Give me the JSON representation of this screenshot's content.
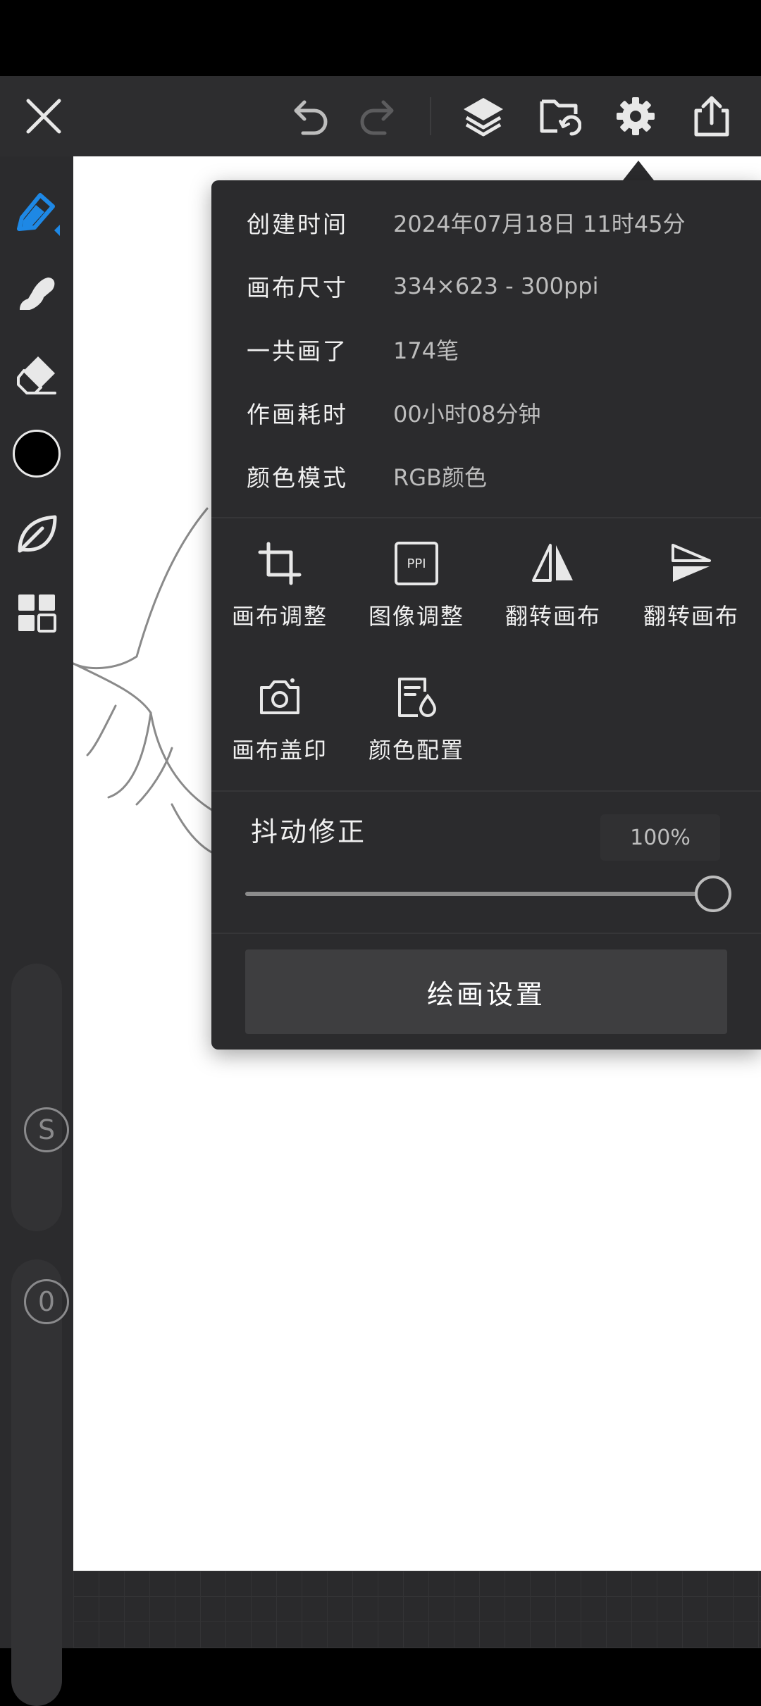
{
  "toolbar": {
    "close": "close-icon",
    "undo": "undo-icon",
    "redo": "redo-icon",
    "layers": "layers-icon",
    "save": "save-folder-icon",
    "settings": "gear-icon",
    "share": "share-icon"
  },
  "left_rail": {
    "tools": [
      "pen-icon",
      "smudge-icon",
      "eraser-icon",
      "color-swatch",
      "leaf-icon",
      "grid-icon"
    ],
    "current_color": "#000000",
    "accent_color": "#1e88e5",
    "size_knob_label": "S",
    "opacity_knob_label": "0"
  },
  "info": {
    "created_label": "创建时间",
    "created_value": "2024年07月18日 11时45分",
    "size_label": "画布尺寸",
    "size_value": "334×623 - 300ppi",
    "strokes_label": "一共画了",
    "strokes_value": "174笔",
    "time_label": "作画耗时",
    "time_value": "00小时08分钟",
    "mode_label": "颜色模式",
    "mode_value": "RGB颜色"
  },
  "actions": {
    "canvas_adjust": "画布调整",
    "image_adjust": "图像调整",
    "flip_h": "翻转画布",
    "flip_v": "翻转画布",
    "canvas_stamp": "画布盖印",
    "color_config": "颜色配置"
  },
  "ppi_badge": "PPI",
  "stabilizer": {
    "label": "抖动修正",
    "value": "100%",
    "level": 1.0
  },
  "settings_button": "绘画设置"
}
